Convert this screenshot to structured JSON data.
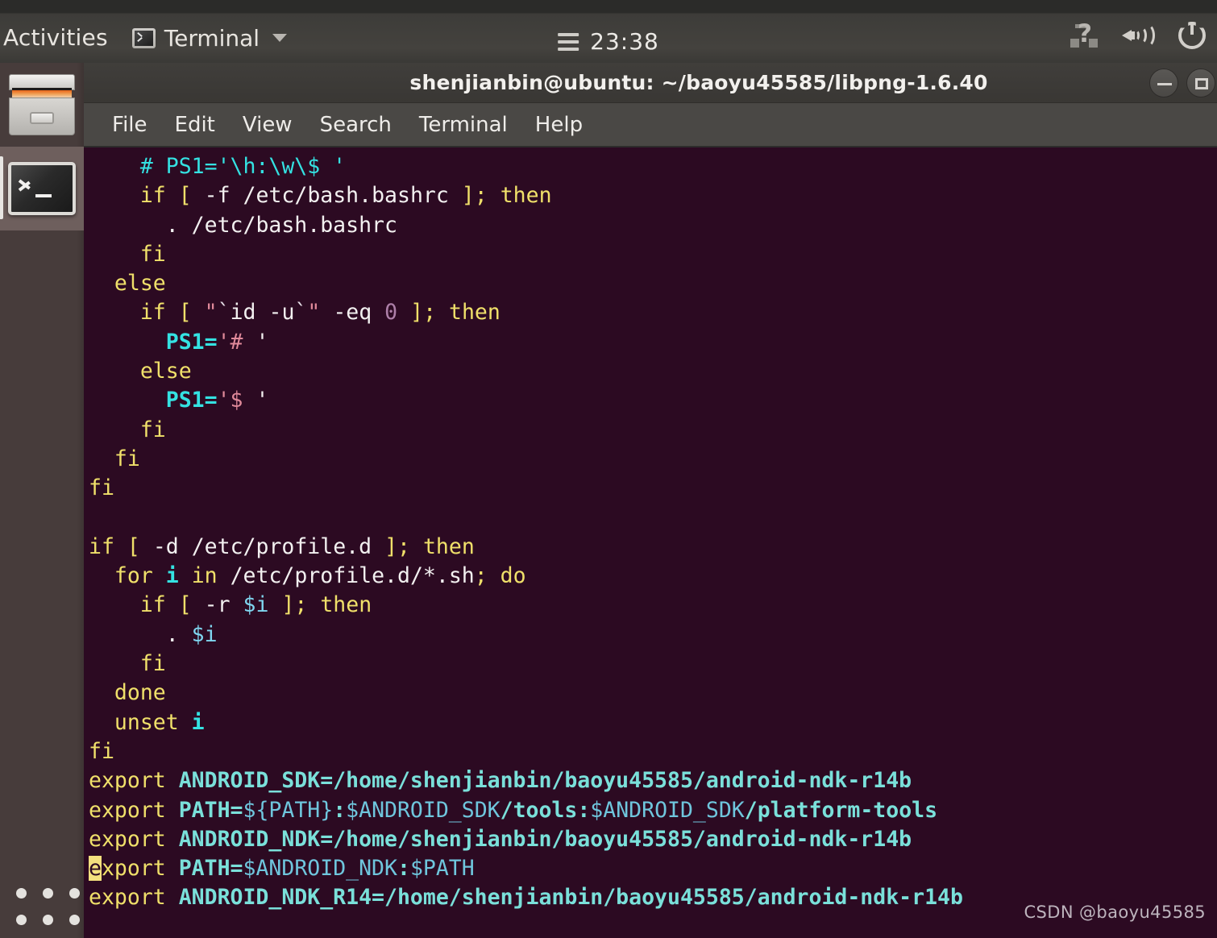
{
  "topbar": {
    "activities_label": "Activities",
    "app_name": "Terminal",
    "app_icon": "terminal-icon",
    "clock": "23:38",
    "menu_icon": "hamburger-menu-icon",
    "network_icon": "network-unknown-icon",
    "volume_icon": "volume-speaker-icon",
    "power_icon": "power-icon"
  },
  "dock": {
    "items": [
      {
        "name": "files",
        "icon": "file-cabinet-icon",
        "active": false
      },
      {
        "name": "terminal",
        "icon": "terminal-icon",
        "active": true
      }
    ],
    "show_applications_label": "Show Applications"
  },
  "window": {
    "title": "shenjianbin@ubuntu: ~/baoyu45585/libpng-1.6.40",
    "buttons": {
      "minimize": "minimize-button",
      "maximize": "maximize-button"
    },
    "menu": [
      "File",
      "Edit",
      "View",
      "Search",
      "Terminal",
      "Help"
    ]
  },
  "terminal": {
    "background_color": "#2c0a22",
    "cursor": {
      "line_index": 30,
      "column_index": 0,
      "char": "e",
      "color": "#f4e07e"
    },
    "colors": {
      "keyword": "#f0e06a",
      "comment": "#34e2e2",
      "text": "#f2f0f0",
      "variable": "#34e2e2",
      "variable_ref": "#7fd6f0",
      "string": "#e0899a",
      "number": "#ad7fa8",
      "path_bold": "#7ae0da",
      "path": "#6fc6dd"
    },
    "lines": [
      "    # PS1='\\h:\\w\\$ '",
      "    if [ -f /etc/bash.bashrc ]; then",
      "      . /etc/bash.bashrc",
      "    fi",
      "  else",
      "    if [ \"`id -u`\" -eq 0 ]; then",
      "      PS1='# '",
      "    else",
      "      PS1='$ '",
      "    fi",
      "  fi",
      "fi",
      "",
      "if [ -d /etc/profile.d ]; then",
      "  for i in /etc/profile.d/*.sh; do",
      "    if [ -r $i ]; then",
      "      . $i",
      "    fi",
      "  done",
      "  unset i",
      "fi",
      "export ANDROID_SDK=/home/shenjianbin/baoyu45585/android-ndk-r14b",
      "export PATH=${PATH}:$ANDROID_SDK/tools:$ANDROID_SDK/platform-tools",
      "export ANDROID_NDK=/home/shenjianbin/baoyu45585/android-ndk-r14b",
      "export PATH=$ANDROID_NDK:$PATH",
      "export ANDROID_NDK_R14=/home/shenjianbin/baoyu45585/android-ndk-r14b"
    ]
  },
  "watermark": "CSDN @baoyu45585"
}
